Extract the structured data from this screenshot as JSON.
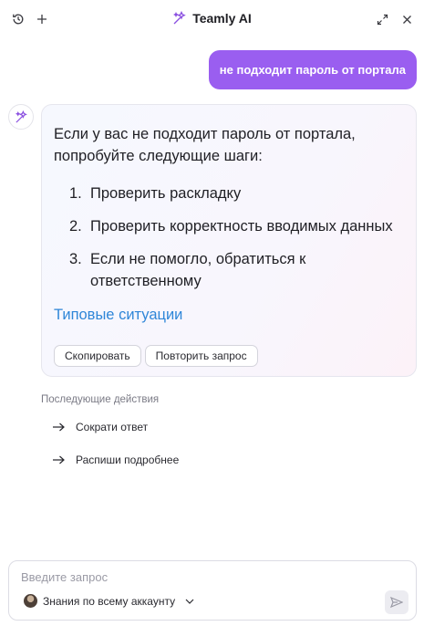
{
  "header": {
    "title": "Teamly AI",
    "history_icon": "history-icon",
    "new_chat_icon": "plus-icon",
    "expand_icon": "expand-icon",
    "close_icon": "close-icon"
  },
  "user_message": "не подходит пароль от портала",
  "ai_message": {
    "intro": "Если у вас не подходит пароль от портала, попробуйте следующие шаги:",
    "steps": [
      {
        "number": "1.",
        "text": "Проверить раскладку"
      },
      {
        "number": "2.",
        "text": "Проверить корректность вводимых данных"
      },
      {
        "number": "3.",
        "text": "Если не помогло, обратиться к ответственному"
      }
    ],
    "link": "Типовые ситуации",
    "copy_button": "Скопировать",
    "retry_button": "Повторить запрос"
  },
  "next_actions": {
    "title": "Последующие действия",
    "items": [
      {
        "label": "Сократи ответ"
      },
      {
        "label": "Распиши подробнее"
      }
    ]
  },
  "composer": {
    "placeholder": "Введите запрос",
    "scope_label": "Знания по всему аккаунту"
  },
  "colors": {
    "accent": "#9a5ef0",
    "link": "#2f86d8"
  }
}
